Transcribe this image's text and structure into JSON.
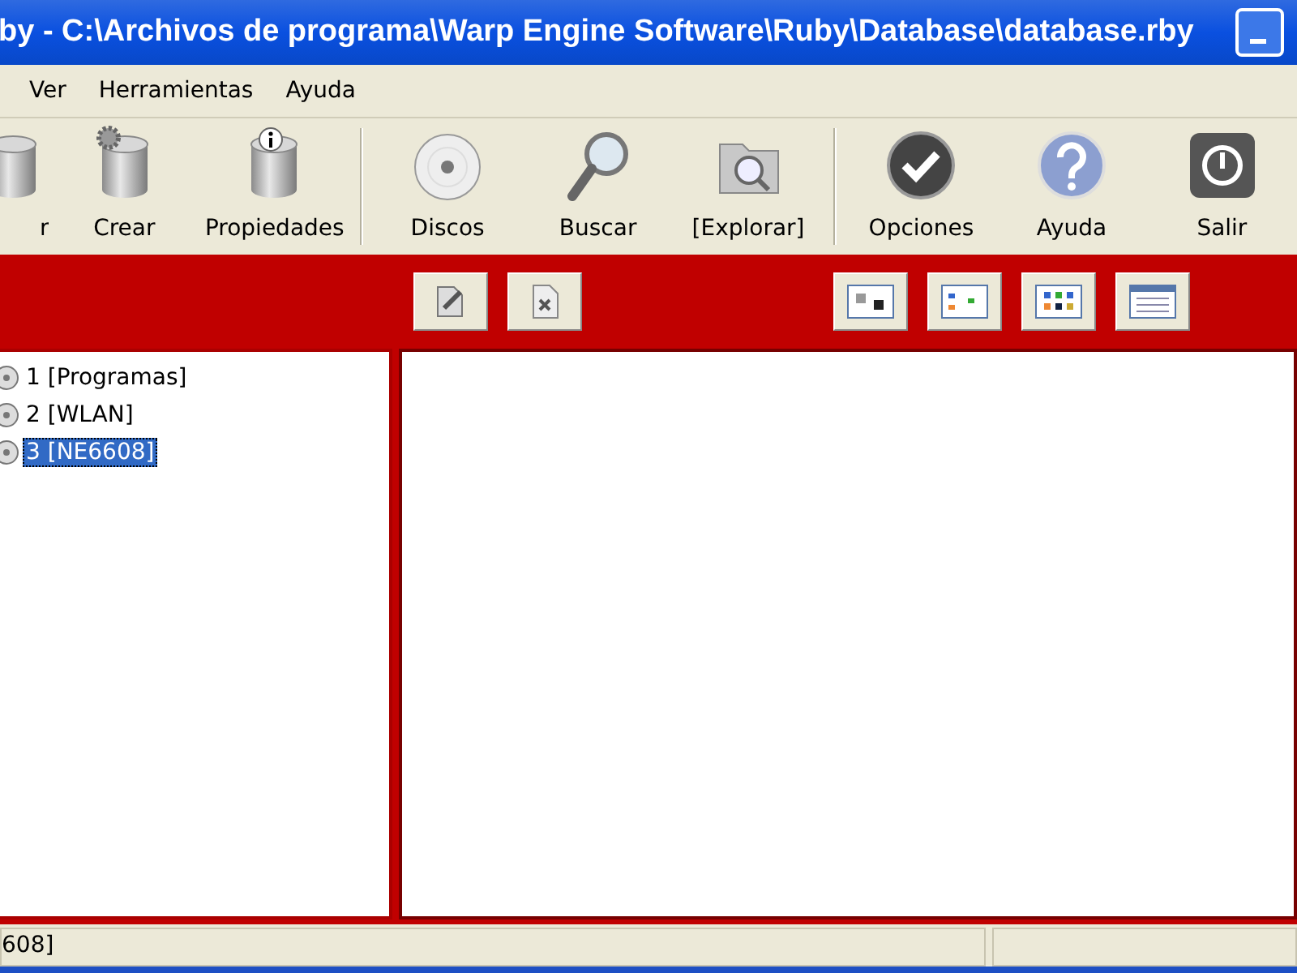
{
  "window": {
    "title": "by - C:\\Archivos de programa\\Warp Engine Software\\Ruby\\Database\\database.rby"
  },
  "menu": [
    "Ver",
    "Herramientas",
    "Ayuda"
  ],
  "toolbar": [
    [
      {
        "kind": "drum",
        "label": "r"
      },
      {
        "kind": "drum-new",
        "label": "Crear"
      },
      {
        "kind": "drum-info",
        "label": "Propiedades"
      }
    ],
    [
      {
        "kind": "disc",
        "label": "Discos"
      },
      {
        "kind": "search",
        "label": "Buscar"
      },
      {
        "kind": "folder",
        "label": "[Explorar]"
      }
    ],
    [
      {
        "kind": "check",
        "label": "Opciones"
      },
      {
        "kind": "help",
        "label": "Ayuda"
      },
      {
        "kind": "power",
        "label": "Salir"
      }
    ]
  ],
  "action_buttons": [
    {
      "kind": "edit"
    },
    {
      "kind": "delete"
    }
  ],
  "view_buttons": [
    {
      "kind": "large"
    },
    {
      "kind": "small"
    },
    {
      "kind": "list"
    },
    {
      "kind": "details"
    }
  ],
  "tree": [
    {
      "label": "1 [Programas]",
      "selected": false
    },
    {
      "label": "2 [WLAN]",
      "selected": false
    },
    {
      "label": "3 [NE6608]",
      "selected": true
    }
  ],
  "status_bar": [
    "608]"
  ]
}
